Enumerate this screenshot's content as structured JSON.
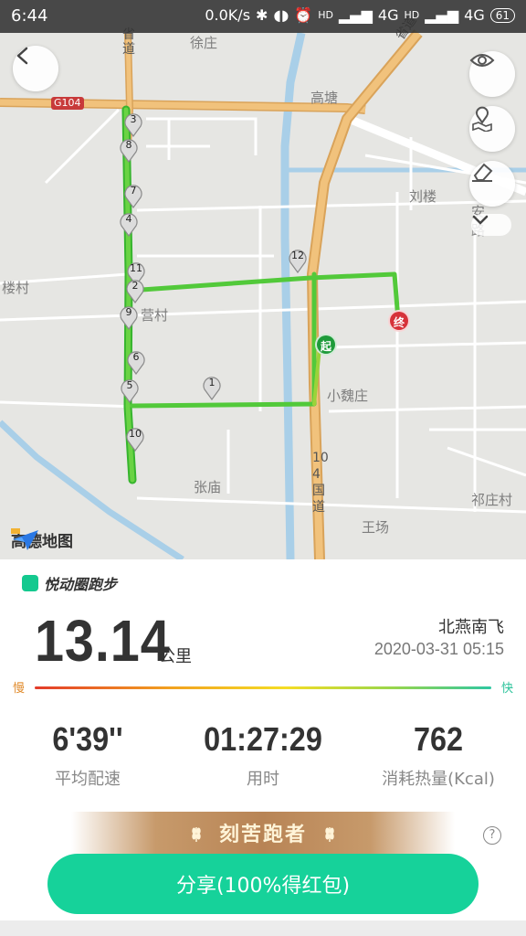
{
  "status_bar": {
    "time": "6:44",
    "network_speed": "0.0K/s",
    "carrier_1": "4G",
    "carrier_2": "4G",
    "hd_1": "HD",
    "hd_2": "HD",
    "battery": "61"
  },
  "map": {
    "labels": {
      "xuzhuang": "徐庄",
      "gaotang": "高塘",
      "liulou": "刘楼",
      "loucun": "楼村",
      "gongcun": "营村",
      "xiaoweizhuang": "小魏庄",
      "zhangmiao": "张庙",
      "wangchang": "王场",
      "zhuangcun": "祁庄村",
      "an_lu": "安\n路",
      "road_104": "104国道",
      "road_top_left": "省\n道",
      "road_top_right": "省道",
      "g104": "G104"
    },
    "markers": [
      "1",
      "2",
      "3",
      "4",
      "5",
      "6",
      "7",
      "8",
      "9",
      "10",
      "11",
      "12"
    ],
    "start_label": "起",
    "end_label": "终",
    "provider": "高德地图",
    "controls": {
      "back": "back-icon",
      "visibility": "eye-icon",
      "map_layer": "map-pin-icon",
      "erase": "eraser-icon",
      "expand": "chevron-down-icon"
    }
  },
  "run": {
    "brand": "悦动圈跑步",
    "distance": "13.14",
    "distance_unit": "公里",
    "username": "北燕南飞",
    "datetime": "2020-03-31 05:15",
    "pace_slow": "慢",
    "pace_fast": "快",
    "stats": [
      {
        "value": "6'39''",
        "label": "平均配速"
      },
      {
        "value": "01:27:29",
        "label": "用时"
      },
      {
        "value": "762",
        "label": "消耗热量(Kcal)"
      }
    ],
    "badge": "刻苦跑者",
    "help": "?",
    "share": "分享(100%得红包)"
  },
  "colors": {
    "accent": "#16d29a",
    "route_green": "#4cd137",
    "start_green": "#1e9b3a",
    "end_red": "#d6323a"
  }
}
